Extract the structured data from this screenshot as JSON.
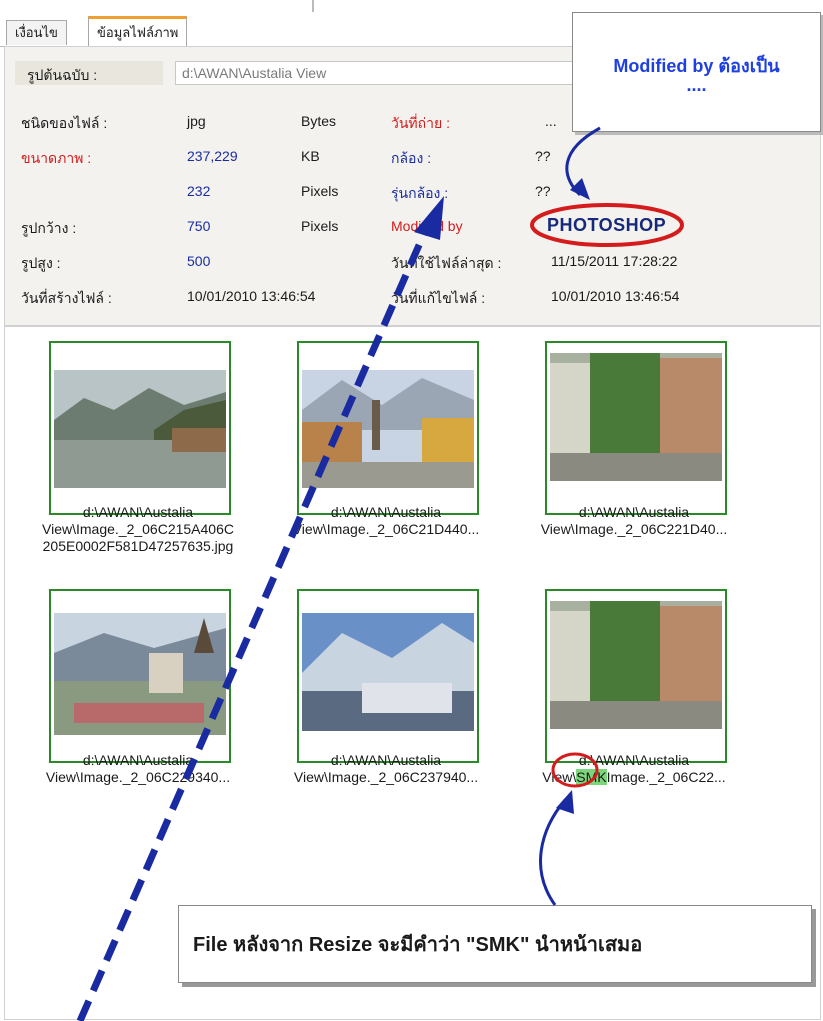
{
  "tabs": [
    "เงื่อนไข",
    "ข้อมูลไฟล์ภาพ"
  ],
  "source": {
    "label": "รูปต้นฉบับ :",
    "path": "d:\\AWAN\\Austalia View"
  },
  "rows": {
    "file_type": {
      "label": "ชนิดของไฟล์ :",
      "value": "jpg",
      "unit": "Bytes"
    },
    "image_size": {
      "label": "ขนาดภาพ :",
      "value": "237,229",
      "unit": "KB"
    },
    "extra": {
      "value": "232",
      "unit": "Pixels"
    },
    "width": {
      "label": "รูปกว้าง :",
      "value": "750",
      "unit": "Pixels"
    },
    "height": {
      "label": "รูปสูง :",
      "value": "500"
    },
    "created": {
      "label": "วันที่สร้างไฟล์ :",
      "value": "10/01/2010 13:46:54"
    }
  },
  "right": {
    "date_taken": {
      "label": "วันที่ถ่าย :",
      "value": "..."
    },
    "camera": {
      "label": "กล้อง :",
      "value": "??"
    },
    "model": {
      "label": "รุ่นกล้อง :",
      "value": "??"
    },
    "modified_by": {
      "label": "Modified by",
      "value": "PHOTOSHOP"
    },
    "last_used": {
      "label": "วันที่ใช้ไฟล์ล่าสุด :",
      "value": "11/15/2011 17:28:22"
    },
    "modified": {
      "label": "วันที่แก้ไขไฟล์ :",
      "value": "10/01/2010 13:46:54"
    }
  },
  "callout_top": {
    "line1": "Modified by ต้องเป็น",
    "line2": "...."
  },
  "thumbnails": [
    {
      "line1": "d:\\AWAN\\Austalia",
      "line2": "View\\Image._2_06C215A406C",
      "line3": "205E0002F581D47257635.jpg"
    },
    {
      "line1": "d:\\AWAN\\Austalia",
      "line2": "View\\Image._2_06C21D440..."
    },
    {
      "line1": "d:\\AWAN\\Austalia",
      "line2": "View\\Image._2_06C221D40..."
    },
    {
      "line1": "d:\\AWAN\\Austalia",
      "line2": "View\\Image._2_06C229340..."
    },
    {
      "line1": "d:\\AWAN\\Austalia",
      "line2": "View\\Image._2_06C237940..."
    },
    {
      "line1": "d:\\AWAN\\Austalia",
      "line2_a": "View\\",
      "line2_smk": "SMK",
      "line2_b": "Image._2_06C22..."
    }
  ],
  "callout_bottom": "File หลังจาก Resize จะมีคำว่า \"SMK\" นำหน้าเสมอ",
  "colors": {
    "accent_red": "#d41c1c",
    "label_blue": "#1a2ca0",
    "thumb_border": "#2a8a2a",
    "arrow": "#1a2aa0"
  }
}
